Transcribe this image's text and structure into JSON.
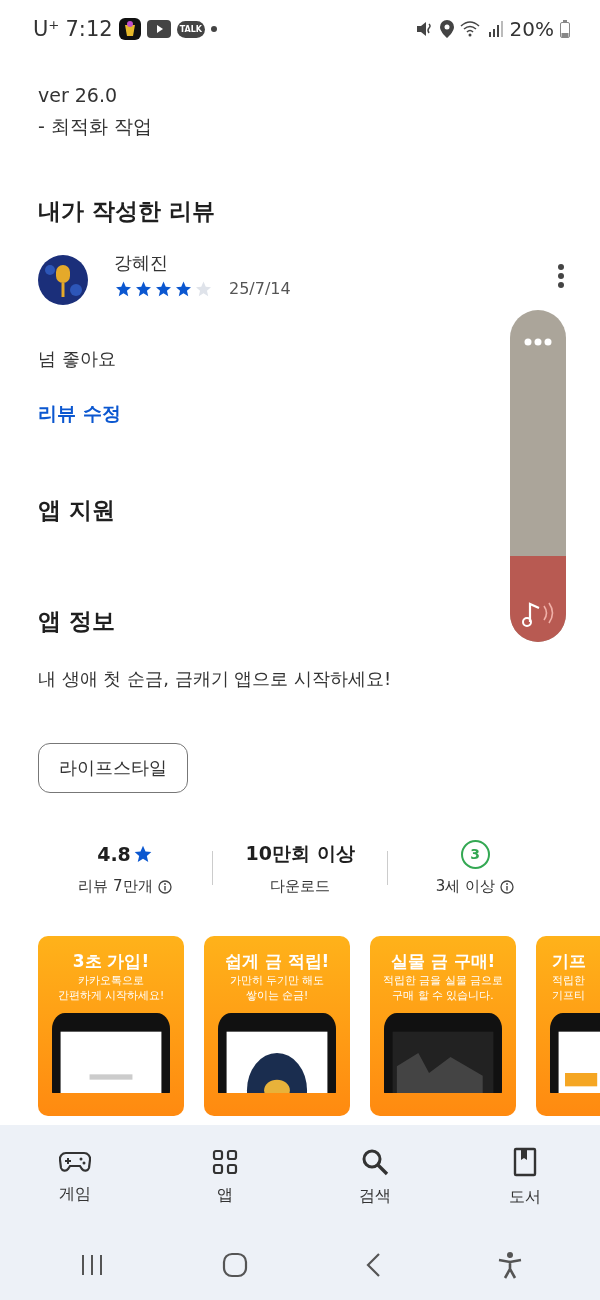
{
  "status_bar": {
    "carrier": "U⁺",
    "time": "7:12",
    "talk_label": "TALK",
    "battery": "20%"
  },
  "update": {
    "version": "ver 26.0",
    "notes": "- 최적화 작업"
  },
  "my_review": {
    "heading": "내가 작성한 리뷰",
    "author": "강혜진",
    "stars": 4,
    "date": "25/7/14",
    "text": "넘 좋아요",
    "edit_link": "리뷰 수정"
  },
  "support": {
    "heading": "앱 지원"
  },
  "about": {
    "heading": "앱 정보",
    "description": "내 생애 첫 순금, 금캐기 앱으로 시작하세요!",
    "category": "라이프스타일"
  },
  "stats": [
    {
      "kind": "rating",
      "value": "4.8",
      "label": "리뷰 7만개"
    },
    {
      "kind": "plain",
      "value": "10만회 이상",
      "label": "다운로드"
    },
    {
      "kind": "age",
      "value": "3",
      "label": "3세 이상"
    }
  ],
  "screenshots": [
    {
      "title": "3초 가입!",
      "subtitle": [
        "카카오톡으로",
        "간편하게 시작하세요!"
      ]
    },
    {
      "title": "쉽게 금 적립!",
      "subtitle": [
        "가만히 두기만 해도",
        "쌓이는 순금!"
      ]
    },
    {
      "title": "실물 금 구매!",
      "subtitle": [
        "적립한 금을 실물 금으로",
        "구매 할 수 있습니다."
      ]
    },
    {
      "title": "기프",
      "subtitle": [
        "적립한",
        "기프티"
      ]
    }
  ],
  "music_widget": {
    "level": 0.26
  },
  "bottom_nav": [
    {
      "label": "게임",
      "kind": "game",
      "selected": false
    },
    {
      "label": "앱",
      "kind": "apps",
      "selected": false
    },
    {
      "label": "검색",
      "kind": "search",
      "selected": false
    },
    {
      "label": "도서",
      "kind": "book",
      "selected": false
    }
  ]
}
